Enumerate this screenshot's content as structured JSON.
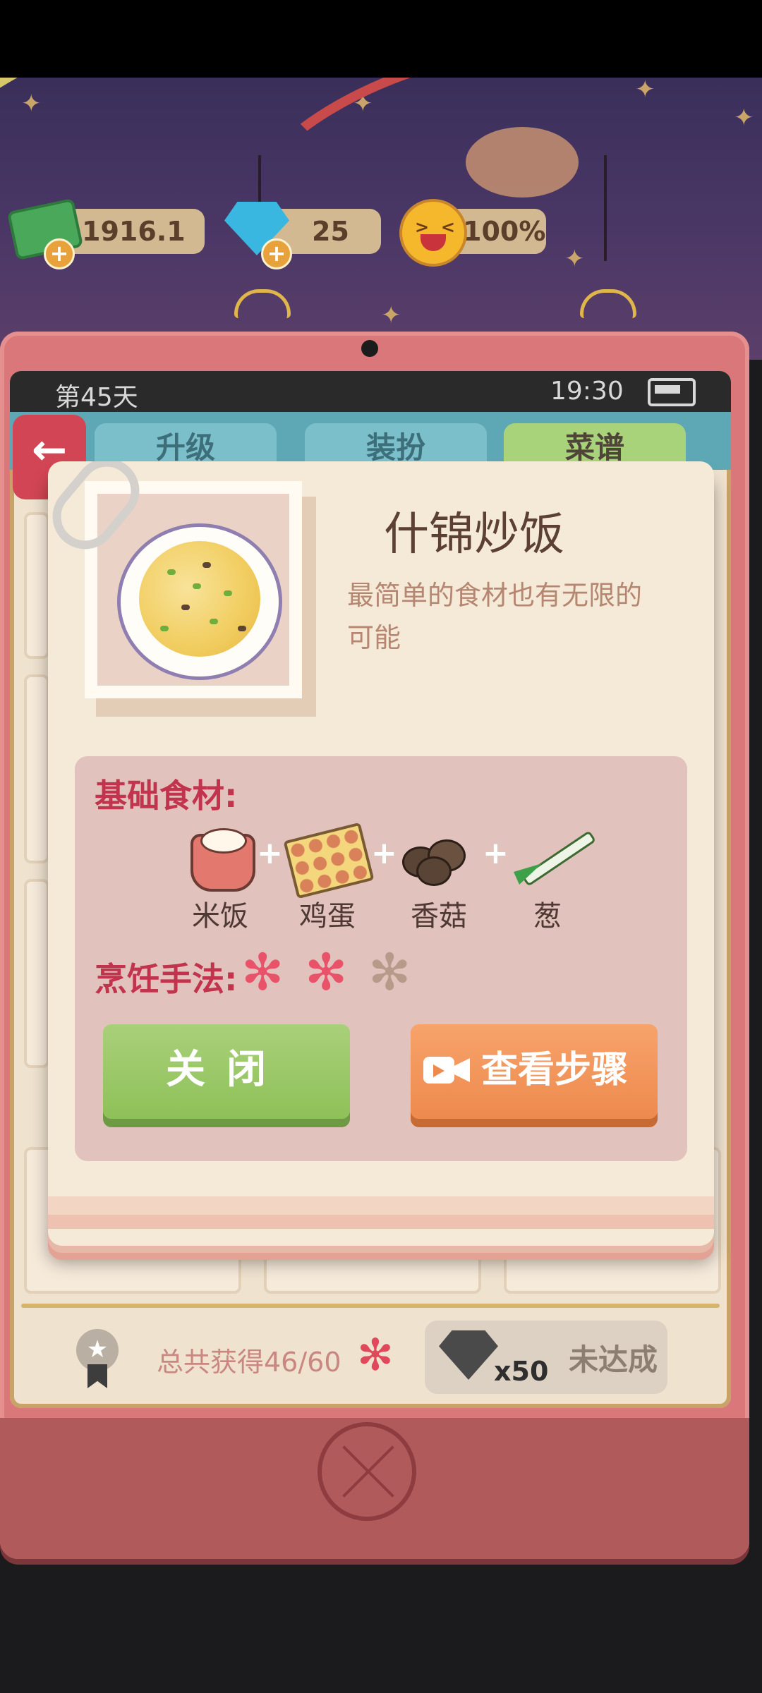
{
  "hud": {
    "cash": "1916.1",
    "gems": "25",
    "satisfaction": "100%"
  },
  "device": {
    "day": "第45天",
    "time": "19:30"
  },
  "tabs": [
    {
      "label": "升级"
    },
    {
      "label": "装扮"
    },
    {
      "label": "菜谱"
    }
  ],
  "bottom": {
    "total": "总共获得46/60",
    "reward_count": "x50",
    "reward_status": "未达成"
  },
  "dialog": {
    "dish_name": "什锦炒饭",
    "description": "最简单的食材也有无限的可能",
    "ingredients_label": "基础食材:",
    "ingredients": [
      {
        "name": "米饭",
        "icon": "rice-cooker-icon"
      },
      {
        "name": "鸡蛋",
        "icon": "egg-tray-icon"
      },
      {
        "name": "香菇",
        "icon": "mushroom-icon"
      },
      {
        "name": "葱",
        "icon": "scallion-icon"
      }
    ],
    "plus": "+",
    "method_label": "烹饪手法:",
    "method_rating": 2,
    "method_max": 3,
    "close_label": "关闭",
    "steps_label": "查看步骤"
  },
  "colors": {
    "accent_red": "#c2334e",
    "flower_on": "#e8536a",
    "flower_off": "#b89a8a",
    "close_green": "#8ec158",
    "steps_orange": "#ee8a4e"
  }
}
